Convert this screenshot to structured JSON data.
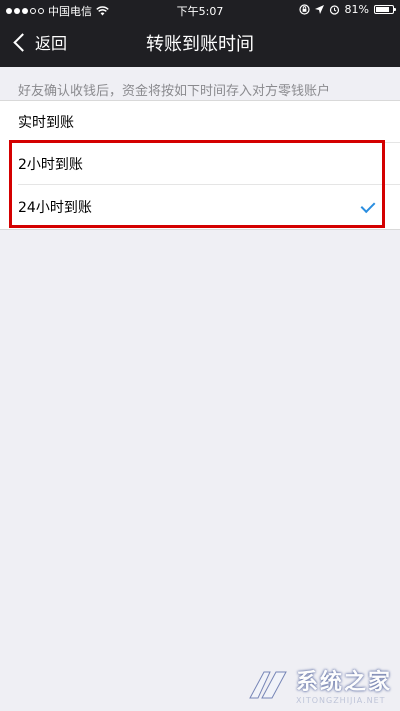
{
  "status_bar": {
    "carrier": "中国电信",
    "time": "下午5:07",
    "battery": "81%",
    "battery_level": 0.81
  },
  "nav": {
    "back_label": "返回",
    "title": "转账到账时间"
  },
  "description": "好友确认收钱后，资金将按如下时间存入对方零钱账户",
  "options": [
    {
      "label": "实时到账",
      "selected": false
    },
    {
      "label": "2小时到账",
      "selected": false
    },
    {
      "label": "24小时到账",
      "selected": true
    }
  ],
  "colors": {
    "nav_bg": "#1f1f23",
    "page_bg": "#efeff4",
    "check": "#2a8ee0",
    "highlight": "#d40000"
  },
  "icons": {
    "back": "chevron-left-icon",
    "check": "checkmark-icon",
    "wifi": "wifi-icon",
    "lock": "orientation-lock-icon",
    "location": "location-arrow-icon",
    "alarm": "alarm-icon"
  },
  "watermark": {
    "text": "系统之家",
    "sub": "XITONGZHIJIA.NET"
  }
}
